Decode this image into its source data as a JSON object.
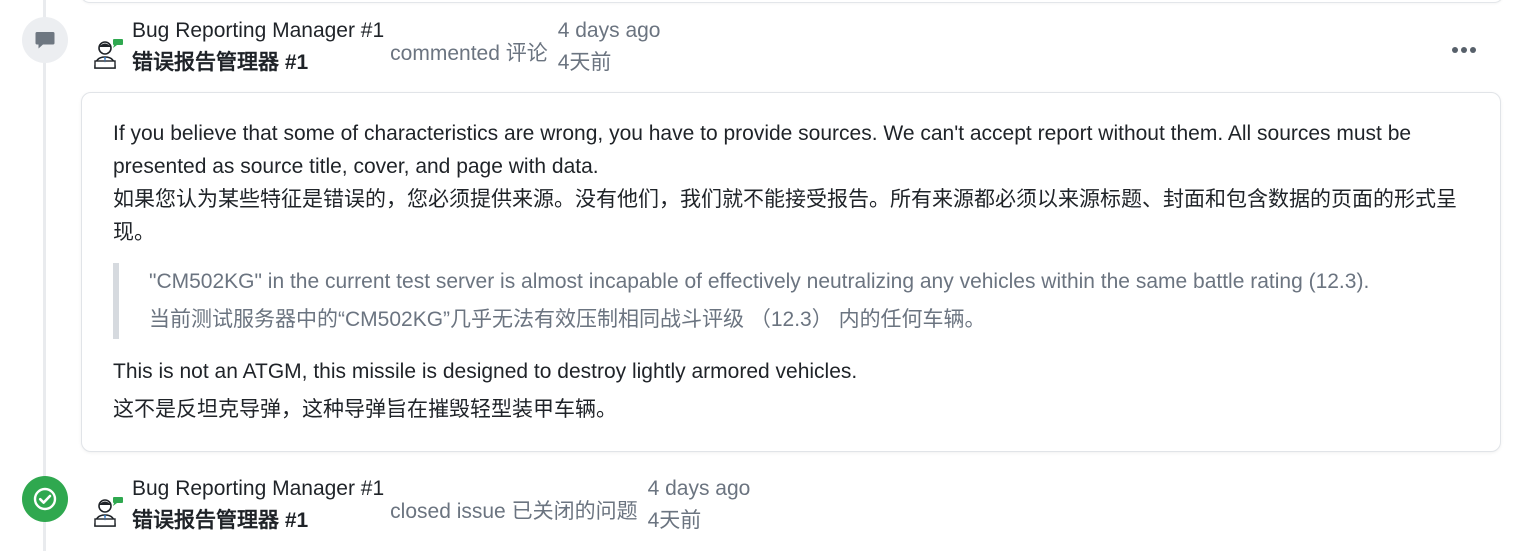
{
  "timeline": {
    "entries": [
      {
        "type": "comment",
        "author_en": "Bug Reporting Manager #1",
        "author_zh": "错误报告管理器 #1",
        "action": "commented 评论",
        "time_en": "4 days ago",
        "time_zh": "4天前",
        "badge_icon": "comment-icon",
        "more_icon": "more-options-icon"
      },
      {
        "type": "closed",
        "author_en": "Bug Reporting Manager #1",
        "author_zh": "错误报告管理器 #1",
        "action": "closed issue 已关闭的问题",
        "time_en": "4 days ago",
        "time_zh": "4天前",
        "badge_icon": "check-circle-icon"
      }
    ]
  },
  "comment": {
    "para1_en": "If you believe that some of characteristics are wrong, you have to provide sources. We can't accept report without them. All sources must be presented as source title, cover, and page with data.",
    "para1_zh": "如果您认为某些特征是错误的，您必须提供来源。没有他们，我们就不能接受报告。所有来源都必须以来源标题、封面和包含数据的页面的形式呈现。",
    "quote_en": "\"CM502KG\" in the current test server is almost incapable of effectively neutralizing any vehicles within the same battle rating (12.3).",
    "quote_zh": "当前测试服务器中的“CM502KG”几乎无法有效压制相同战斗评级 （12.3） 内的任何车辆。",
    "para2_en": "This is not an ATGM, this missile is designed to destroy lightly armored vehicles.",
    "para2_zh": "这不是反坦克导弹，这种导弹旨在摧毁轻型装甲车辆。"
  },
  "colors": {
    "closed_badge": "#2fa84f",
    "comment_badge": "#eceef1",
    "muted_text": "#6b7480"
  }
}
